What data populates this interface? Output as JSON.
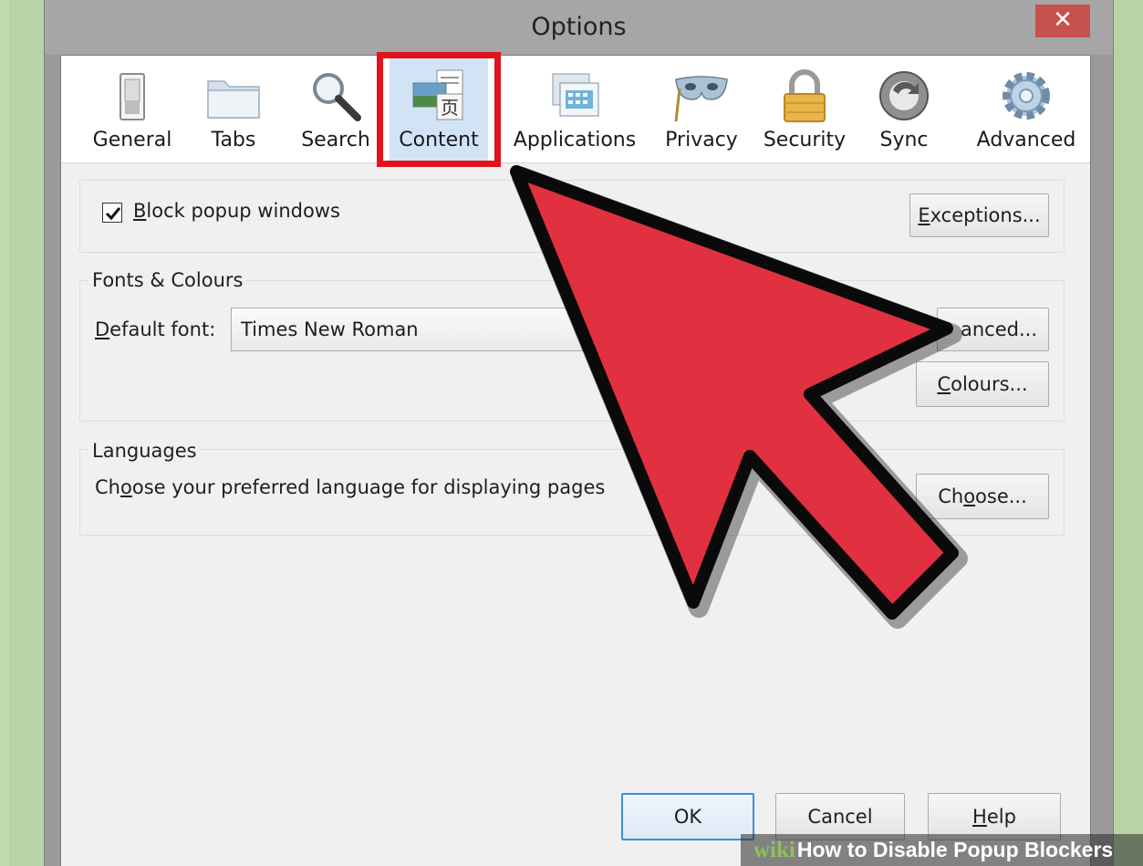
{
  "window": {
    "title": "Options",
    "close_glyph": "✕"
  },
  "toolbar": {
    "tabs": [
      {
        "label": "General",
        "icon": "switch-icon"
      },
      {
        "label": "Tabs",
        "icon": "folder-icon"
      },
      {
        "label": "Search",
        "icon": "magnifier-icon"
      },
      {
        "label": "Content",
        "icon": "content-page-icon",
        "selected": true
      },
      {
        "label": "Applications",
        "icon": "applications-icon"
      },
      {
        "label": "Privacy",
        "icon": "mask-icon"
      },
      {
        "label": "Security",
        "icon": "padlock-icon"
      },
      {
        "label": "Sync",
        "icon": "sync-icon"
      },
      {
        "label": "Advanced",
        "icon": "gear-icon"
      }
    ],
    "content_icon_glyph": "页"
  },
  "popups": {
    "checkbox_checked": true,
    "check_glyph": "✔",
    "label_key": "B",
    "label_rest": "lock popup windows",
    "exceptions_key": "E",
    "exceptions_rest": "xceptions..."
  },
  "fonts": {
    "group_label": "Fonts & Colours",
    "default_font_key": "D",
    "default_font_rest": "efault font:",
    "font_value": "Times New Roman",
    "advanced_visible": "anced...",
    "colours_key": "C",
    "colours_rest": "olours..."
  },
  "languages": {
    "group_label": "Languages",
    "text_before": "Ch",
    "text_key": "o",
    "text_after": "ose your preferred language for displaying pages",
    "choose_before": "Ch",
    "choose_key": "o",
    "choose_after": "ose..."
  },
  "footer": {
    "ok": "OK",
    "cancel": "Cancel",
    "help_key": "H",
    "help_rest": "elp"
  },
  "watermark": {
    "wiki": "wiki",
    "text": "How to Disable Popup Blockers"
  },
  "colors": {
    "highlight": "#e0141d",
    "arrow": "#e1303f",
    "selected_tab": "#d3e3f6"
  }
}
